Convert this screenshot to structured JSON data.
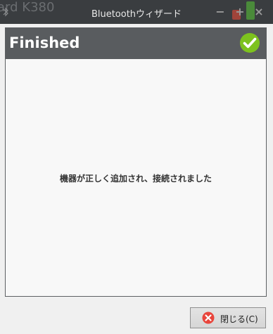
{
  "window": {
    "title": "Bluetoothウィザード",
    "background_text": "ard K380",
    "minimize_glyph": "−",
    "maximize_glyph": "+",
    "close_glyph": "×"
  },
  "header": {
    "title": "Finished",
    "icon": "check-circle-icon",
    "icon_color": "#7dc21e",
    "background": "#595c5f"
  },
  "content": {
    "message": "機器が正しく追加され、接続されました"
  },
  "footer": {
    "close_label": "閉じる(C)",
    "close_icon": "x-circle-icon",
    "close_icon_color": "#e8453c"
  }
}
